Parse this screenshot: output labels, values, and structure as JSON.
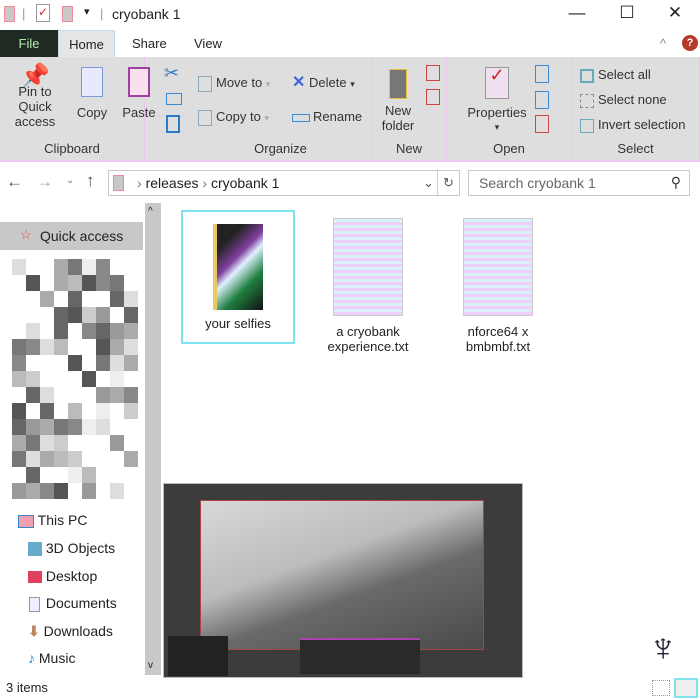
{
  "window": {
    "title": "cryobank 1",
    "minimize": "—",
    "maximize": "☐",
    "close": "✕"
  },
  "tabs": [
    {
      "label": "File"
    },
    {
      "label": "Home"
    },
    {
      "label": "Share"
    },
    {
      "label": "View"
    }
  ],
  "ribbon": {
    "clipboard": {
      "label": "Clipboard",
      "pin": "Pin to Quick access",
      "copy": "Copy",
      "paste": "Paste"
    },
    "organize": {
      "label": "Organize",
      "move_to": "Move to",
      "copy_to": "Copy to",
      "delete": "Delete",
      "rename": "Rename"
    },
    "new": {
      "label": "New",
      "new_folder": "New folder"
    },
    "open": {
      "label": "Open",
      "properties": "Properties"
    },
    "select": {
      "label": "Select",
      "select_all": "Select all",
      "select_none": "Select none",
      "invert": "Invert selection"
    }
  },
  "address": {
    "path": [
      "releases",
      "cryobank 1"
    ],
    "search_placeholder": "Search cryobank 1"
  },
  "nav": {
    "quick_access": "Quick access",
    "this_pc": "This PC",
    "items": [
      "3D Objects",
      "Desktop",
      "Documents",
      "Downloads",
      "Music"
    ]
  },
  "files": [
    {
      "name": "your selfies",
      "type": "folder",
      "selected": true
    },
    {
      "name": "a cryobank experience.txt",
      "type": "text"
    },
    {
      "name": "nforce64 x bmbmbf.txt",
      "type": "text"
    }
  ],
  "status": {
    "count": "3 items"
  },
  "colors": {
    "accent": "#7fe3ef",
    "file_tab": "#1e2a22"
  }
}
